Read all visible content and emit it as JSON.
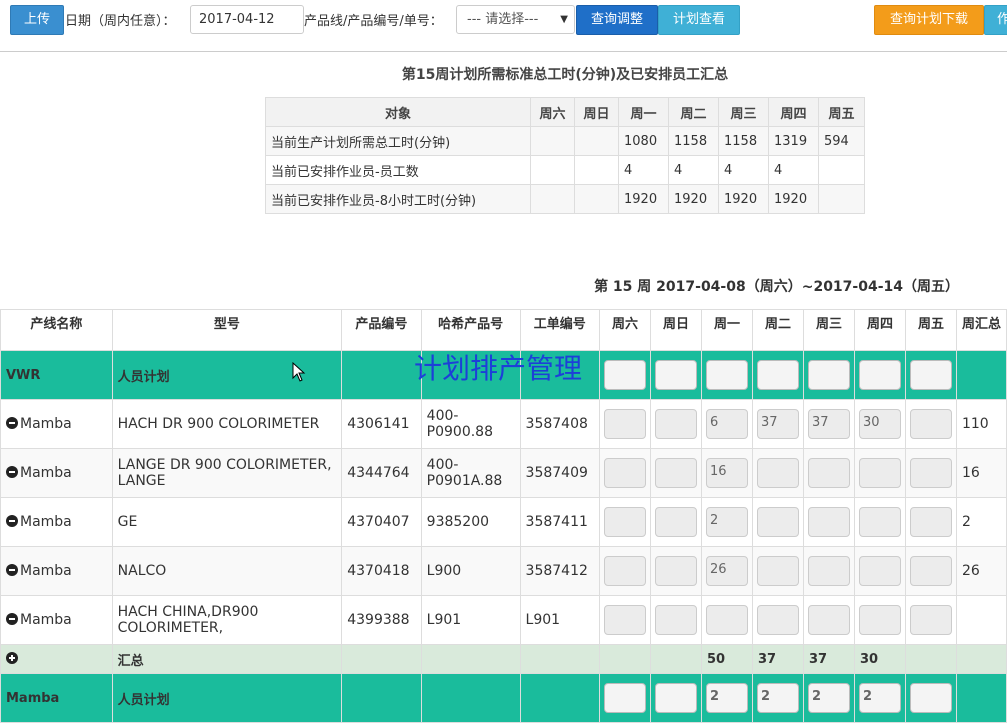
{
  "toolbar": {
    "upload_label": "上传",
    "date_label": "日期（周内任意）：",
    "date_value": "2017-04-12",
    "filter_label": "产品线/产品编号/单号：",
    "select_value": "--- 请选择---",
    "query_label": "查询调整",
    "plan_view_label": "计划查看",
    "download_label": "查询计划下载",
    "extra_label": "作"
  },
  "summary": {
    "title": "第15周计划所需标准总工时(分钟)及已安排员工汇总",
    "headers": [
      "对象",
      "周六",
      "周日",
      "周一",
      "周二",
      "周三",
      "周四",
      "周五"
    ],
    "rows": [
      [
        "当前生产计划所需总工时(分钟)",
        "",
        "",
        "1080",
        "1158",
        "1158",
        "1319",
        "594"
      ],
      [
        "当前已安排作业员-员工数",
        "",
        "",
        "4",
        "4",
        "4",
        "4",
        ""
      ],
      [
        "当前已安排作业员-8小时工时(分钟)",
        "",
        "",
        "1920",
        "1920",
        "1920",
        "1920",
        ""
      ]
    ]
  },
  "week_header": "第 15 周  2017-04-08（周六）~2017-04-14（周五）",
  "overlay_title": "计划排产管理",
  "grid": {
    "headers": [
      "产线名称",
      "型号",
      "产品编号",
      "哈希产品号",
      "工单编号",
      "周六",
      "周日",
      "周一",
      "周二",
      "周三",
      "周四",
      "周五",
      "周汇总"
    ],
    "plan_row_1": {
      "line": "VWR",
      "model": "人员计划",
      "days": [
        "",
        "",
        "",
        "",
        "",
        "",
        ""
      ]
    },
    "items": [
      {
        "line": "Mamba",
        "model": "HACH DR 900 COLORIMETER",
        "product_no": "4306141",
        "hach_no": "400-P0900.88",
        "order_no": "3587408",
        "days": [
          "",
          "",
          "6",
          "37",
          "37",
          "30",
          ""
        ],
        "total": "110"
      },
      {
        "line": "Mamba",
        "model": "LANGE DR 900 COLORIMETER, LANGE",
        "product_no": "4344764",
        "hach_no": "400-P0901A.88",
        "order_no": "3587409",
        "days": [
          "",
          "",
          "16",
          "",
          "",
          "",
          ""
        ],
        "total": "16"
      },
      {
        "line": "Mamba",
        "model": "GE",
        "product_no": "4370407",
        "hach_no": "9385200",
        "order_no": "3587411",
        "days": [
          "",
          "",
          "2",
          "",
          "",
          "",
          ""
        ],
        "total": "2"
      },
      {
        "line": "Mamba",
        "model": "NALCO",
        "product_no": "4370418",
        "hach_no": "L900",
        "order_no": "3587412",
        "days": [
          "",
          "",
          "26",
          "",
          "",
          "",
          ""
        ],
        "total": "26"
      },
      {
        "line": "Mamba",
        "model": "HACH CHINA,DR900 COLORIMETER,",
        "product_no": "4399388",
        "hach_no": "L901",
        "order_no": "L901",
        "days": [
          "",
          "",
          "",
          "",
          "",
          "",
          ""
        ],
        "total": ""
      }
    ],
    "total_row": {
      "label": "汇总",
      "days": [
        "",
        "",
        "50",
        "37",
        "37",
        "30",
        ""
      ]
    },
    "plan_row_2": {
      "line": "Mamba",
      "model": "人员计划",
      "days": [
        "",
        "",
        "2",
        "2",
        "2",
        "2",
        ""
      ]
    }
  }
}
